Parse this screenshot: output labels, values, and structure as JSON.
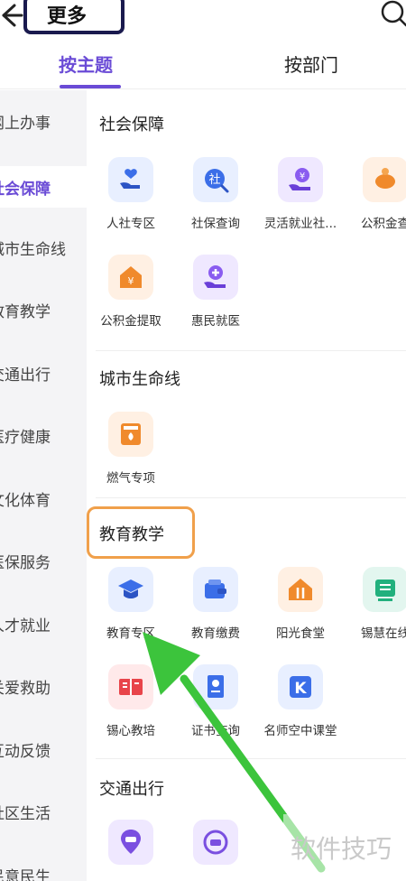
{
  "header": {
    "title": "更多"
  },
  "tabs": [
    {
      "label": "按主题"
    },
    {
      "label": "按部门"
    }
  ],
  "sidebar": {
    "items": [
      {
        "label": "网上办事"
      },
      {
        "label": "社会保障"
      },
      {
        "label": "城市生命线"
      },
      {
        "label": "教育教学"
      },
      {
        "label": "交通出行"
      },
      {
        "label": "医疗健康"
      },
      {
        "label": "文化体育"
      },
      {
        "label": "医保服务"
      },
      {
        "label": "人才就业"
      },
      {
        "label": "关爱救助"
      },
      {
        "label": "互动反馈"
      },
      {
        "label": "社区生活"
      },
      {
        "label": "民意民生"
      }
    ],
    "active_index": 1
  },
  "sections": {
    "social": {
      "title": "社会保障",
      "items": [
        {
          "label": "人社专区",
          "icon": "hand-heart-icon"
        },
        {
          "label": "社保查询",
          "icon": "social-security-search-icon"
        },
        {
          "label": "灵活就业社...",
          "icon": "hand-money-icon"
        },
        {
          "label": "公积金查",
          "icon": "piggy-bank-icon"
        },
        {
          "label": "公积金提取",
          "icon": "house-money-icon"
        },
        {
          "label": "惠民就医",
          "icon": "hand-medical-icon"
        }
      ]
    },
    "lifeline": {
      "title": "城市生命线",
      "items": [
        {
          "label": "燃气专项",
          "icon": "gas-stove-icon"
        }
      ]
    },
    "education": {
      "title": "教育教学",
      "items": [
        {
          "label": "教育专区",
          "icon": "graduation-cap-icon"
        },
        {
          "label": "教育缴费",
          "icon": "wallet-icon"
        },
        {
          "label": "阳光食堂",
          "icon": "house-fork-icon"
        },
        {
          "label": "锡慧在线",
          "icon": "screen-icon"
        },
        {
          "label": "锡心教培",
          "icon": "book-icon"
        },
        {
          "label": "证书查询",
          "icon": "certificate-icon"
        },
        {
          "label": "名师空中课堂",
          "icon": "k-logo-icon"
        }
      ]
    },
    "traffic": {
      "title": "交通出行",
      "items": [
        {
          "label": "",
          "icon": "car-location-icon"
        },
        {
          "label": "",
          "icon": "car-refresh-icon"
        }
      ]
    }
  },
  "watermark": "软件技巧",
  "colors": {
    "accent": "#6a4bd6",
    "highlight": "#f0a04b",
    "arrow": "#3cc43c",
    "title_box_border": "#1a1a4e"
  }
}
